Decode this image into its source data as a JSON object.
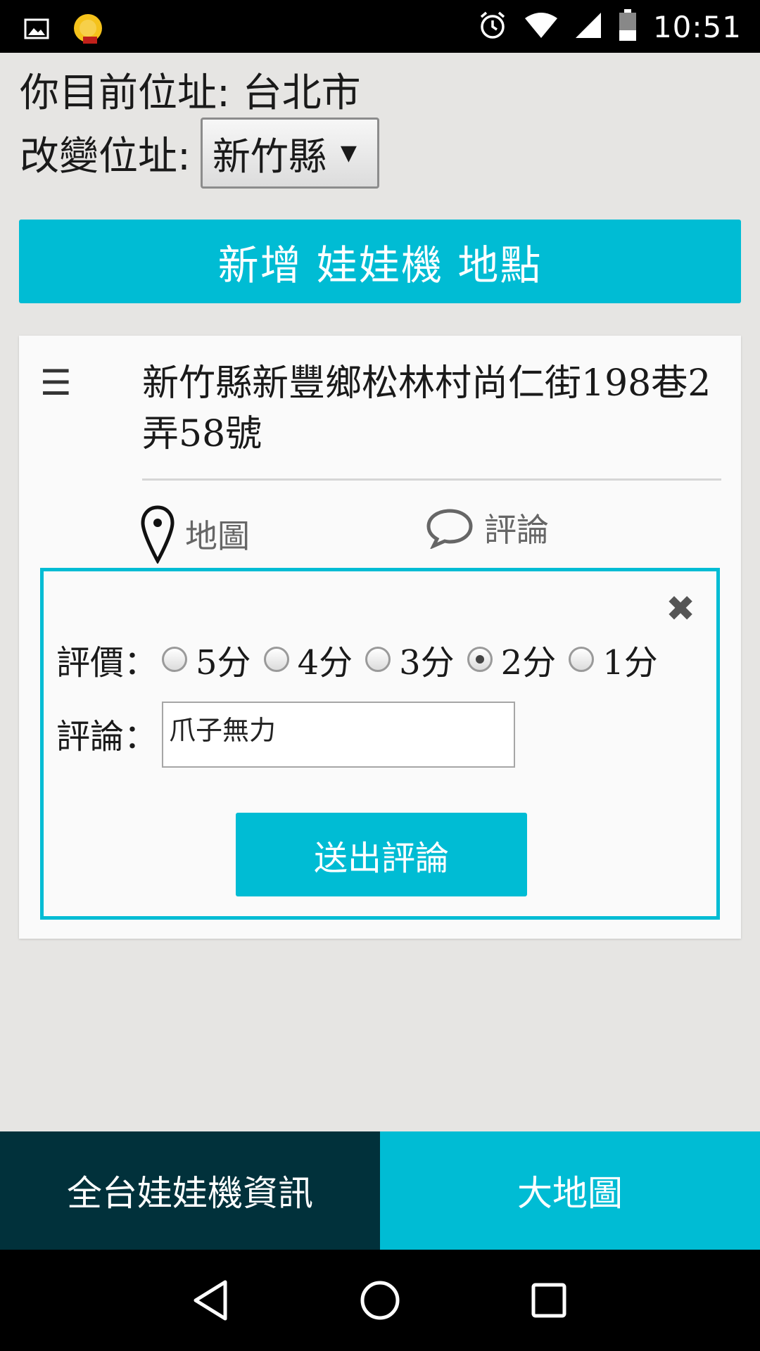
{
  "status_bar": {
    "time": "10:51",
    "icons": [
      "image-icon",
      "app-icon",
      "alarm-icon",
      "wifi-icon",
      "signal-icon",
      "battery-icon"
    ]
  },
  "location": {
    "current": "你目前位址: 台北市",
    "change_label": "改變位址:",
    "selected_city": "新竹縣"
  },
  "add_button_label": "新增 娃娃機 地點",
  "card": {
    "address": "新竹縣新豐鄉松林村尚仁街198巷2弄58號",
    "map_label": "地圖",
    "comment_label": "評論"
  },
  "review": {
    "rating_label": "評價：",
    "options": [
      "5分",
      "4分",
      "3分",
      "2分",
      "1分"
    ],
    "selected": "2分",
    "comment_label": "評論：",
    "comment_value": "爪子無力",
    "submit_label": "送出評論"
  },
  "bottom_tabs": {
    "left": "全台娃娃機資訊",
    "right": "大地圖"
  },
  "colors": {
    "accent": "#00bcd4",
    "dark_tab": "#01313b",
    "background": "#e6e5e3"
  }
}
